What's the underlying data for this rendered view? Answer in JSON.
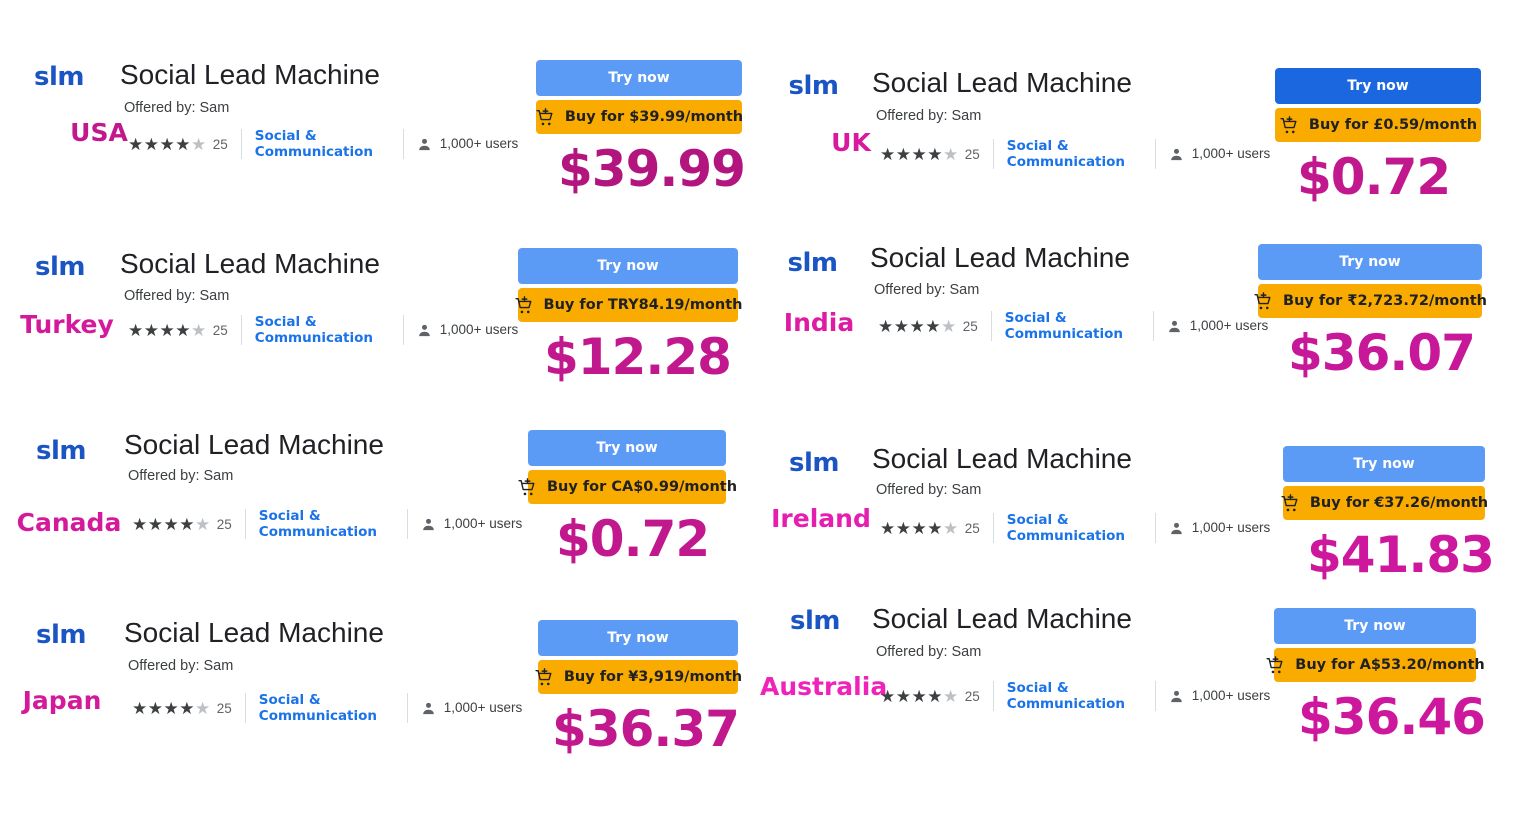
{
  "theme": {
    "logo_blue": "#1b55c4",
    "category_blue": "#1a73e8",
    "star_on": "#3c4043",
    "star_off": "#bdc1c6",
    "buy_yellow": "#f9ab00",
    "title_color": "#202124"
  },
  "common": {
    "app_name": "Social Lead Machine",
    "logo_text": "slm",
    "offered_by": "Offered by: Sam",
    "rating_count": "25",
    "stars_filled": 4,
    "stars_total": 5,
    "category": "Social & Communication",
    "users": "1,000+ users",
    "try_label": "Try now",
    "logo_icon": "slm-wordmark-logo",
    "cart_icon": "add-to-cart-icon",
    "user_icon": "user-person-icon",
    "star_icon": "star-icon"
  },
  "listings": [
    {
      "country": "USA",
      "country_color": "#c2188d",
      "buy_label": "Buy for $39.99/month",
      "price": "$39.99",
      "price_color": "#b3157f",
      "try_color": "#5b9bf5"
    },
    {
      "country": "UK",
      "country_color": "#d81b9e",
      "buy_label": "Buy for £0.59/month",
      "price": "$0.72",
      "price_color": "#c2188d",
      "try_color": "#1a67e0"
    },
    {
      "country": "Turkey",
      "country_color": "#d41a9b",
      "buy_label": "Buy for TRY84.19/month",
      "price": "$12.28",
      "price_color": "#c2188d",
      "try_color": "#5b9bf5"
    },
    {
      "country": "India",
      "country_color": "#de1ca3",
      "buy_label": "Buy for ₹2,723.72/month",
      "price": "$36.07",
      "price_color": "#c8189a",
      "try_color": "#5b9bf5"
    },
    {
      "country": "Canada",
      "country_color": "#d41a9b",
      "buy_label": "Buy for CA$0.99/month",
      "price": "$0.72",
      "price_color": "#c2188d",
      "try_color": "#5b9bf5"
    },
    {
      "country": "Ireland",
      "country_color": "#e61eb0",
      "buy_label": "Buy for €37.26/month",
      "price": "$41.83",
      "price_color": "#cd189e",
      "try_color": "#5b9bf5"
    },
    {
      "country": "Japan",
      "country_color": "#d41a9b",
      "buy_label": "Buy for ¥3,919/month",
      "price": "$36.37",
      "price_color": "#c2188d",
      "try_color": "#5b9bf5"
    },
    {
      "country": "Australia",
      "country_color": "#ef22ba",
      "buy_label": "Buy for A$53.20/month",
      "price": "$36.46",
      "price_color": "#cd189e",
      "try_color": "#5b9bf5"
    }
  ]
}
